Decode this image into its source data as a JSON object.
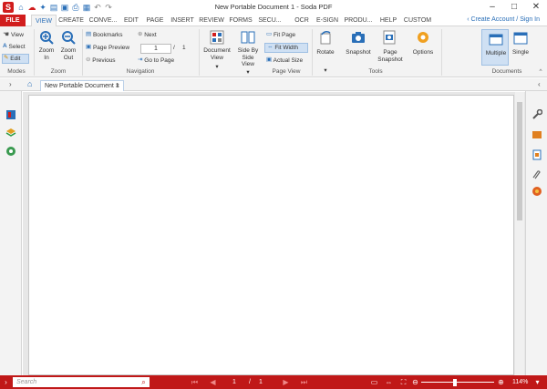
{
  "window": {
    "title": "New Portable Document 1  -  Soda PDF",
    "app_logo": "S",
    "minimize": "–",
    "maximize": "□",
    "close": "✕"
  },
  "menu": {
    "tabs": [
      "FILE",
      "VIEW",
      "CREATE",
      "CONVE...",
      "EDIT",
      "PAGE",
      "INSERT",
      "REVIEW",
      "FORMS",
      "SECU...",
      "OCR",
      "E-SIGN",
      "PRODU...",
      "HELP",
      "CUSTOM"
    ],
    "active_tab": "VIEW",
    "account_link": "Create Account / Sign In"
  },
  "ribbon": {
    "modes": {
      "label": "Modes",
      "view": "View",
      "select": "Select",
      "edit": "Edit"
    },
    "zoom": {
      "label": "Zoom",
      "zoom_in": "Zoom In",
      "zoom_out": "Zoom Out"
    },
    "navigation": {
      "label": "Navigation",
      "bookmarks": "Bookmarks",
      "page_preview": "Page Preview",
      "previous": "Previous",
      "next": "Next",
      "go_to_page": "Go to Page",
      "current_page": "1",
      "separator": "/",
      "total_pages": "1"
    },
    "page_view": {
      "label": "Page View",
      "document_view": "Document View",
      "side_by_side": "Side By Side View",
      "fit_page": "Fit Page",
      "fit_width": "Fit Width",
      "actual_size": "Actual Size"
    },
    "tools": {
      "label": "Tools",
      "rotate": "Rotate",
      "snapshot": "Snapshot",
      "page_snapshot": "Page Snapshot",
      "options": "Options"
    },
    "documents": {
      "label": "Documents",
      "multiple": "Multiple",
      "single": "Single"
    }
  },
  "document_tab": {
    "title": "New Portable Document 1",
    "close": "×"
  },
  "status": {
    "search_placeholder": "Search",
    "page_current": "1",
    "page_separator": "/",
    "page_total": "1",
    "zoom": "114%"
  },
  "colors": {
    "accent_red": "#c01818",
    "accent_blue": "#2a6fb8",
    "ribbon_bg": "#f3f3f3"
  }
}
